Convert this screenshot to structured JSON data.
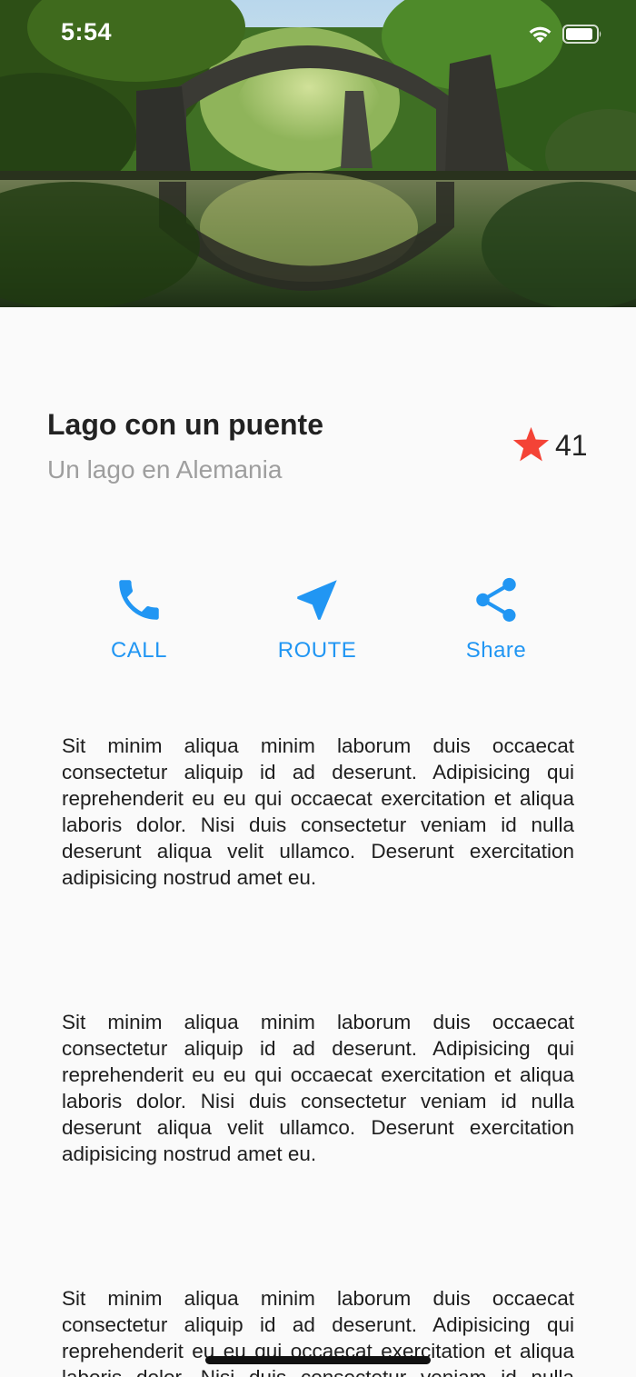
{
  "status_bar": {
    "time": "5:54"
  },
  "hero": {
    "image": "lake-with-bridge-photo"
  },
  "place": {
    "title": "Lago con un puente",
    "subtitle": "Un lago en Alemania",
    "rating_count": "41"
  },
  "actions": [
    {
      "label": "CALL",
      "icon": "phone-icon"
    },
    {
      "label": "ROUTE",
      "icon": "navigation-arrow-icon"
    },
    {
      "label": "Share",
      "icon": "share-icon"
    }
  ],
  "paragraphs": [
    "Sit minim aliqua minim laborum duis occaecat consectetur aliquip id ad deserunt. Adipisicing qui reprehenderit eu eu qui occaecat exercitation et aliqua laboris dolor. Nisi duis consectetur veniam id nulla deserunt aliqua velit ullamco. Deserunt exercitation adipisicing nostrud amet eu.",
    "Sit minim aliqua minim laborum duis occaecat consectetur aliquip id ad deserunt. Adipisicing qui reprehenderit eu eu qui occaecat exercitation et aliqua laboris dolor. Nisi duis consectetur veniam id nulla deserunt aliqua velit ullamco. Deserunt exercitation adipisicing nostrud amet eu.",
    "Sit minim aliqua minim laborum duis occaecat consectetur aliquip id ad deserunt. Adipisicing qui reprehenderit eu eu qui occaecat exercitation et aliqua laboris dolor. Nisi duis consectetur veniam id nulla deserunt aliqua velit ullamco. Deserunt exercitation adipisicing nostrud amet eu."
  ],
  "colors": {
    "accent": "#2196f3",
    "star": "#f44336",
    "title": "#222222",
    "subtitle": "#9e9e9e",
    "background": "#fafafa"
  }
}
